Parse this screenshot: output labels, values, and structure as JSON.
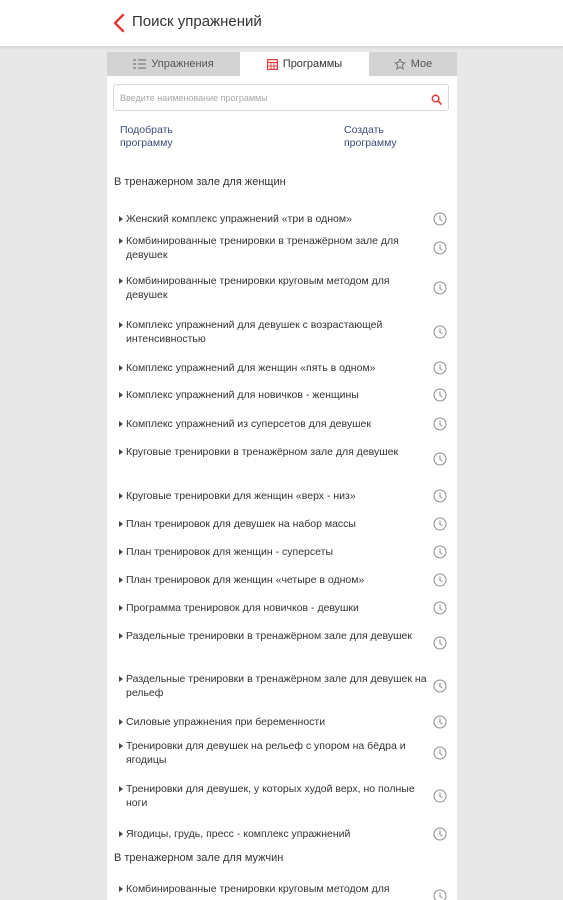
{
  "header": {
    "title": "Поиск упражнений"
  },
  "tabs": [
    {
      "label": "Упражнения",
      "icon": "list-icon"
    },
    {
      "label": "Программы",
      "icon": "calendar-icon"
    },
    {
      "label": "Мое",
      "icon": "star-icon"
    }
  ],
  "search": {
    "placeholder": "Введите наименование программы",
    "value": ""
  },
  "links": {
    "pick": "Подобрать программу",
    "create": "Создать программу"
  },
  "colors": {
    "accent": "#e53935",
    "link": "#3b4a7a"
  },
  "sections": [
    {
      "title": "В тренажерном зале для женщин",
      "items": [
        "Женский комплекс упражнений «три в одном»",
        "Комбинированные тренировки в тренажёрном зале для девушек",
        "Комбинированные тренировки круговым методом для девушек",
        "Комплекс упражнений для девушек с возрастающей интенсивностью",
        "Комплекс упражнений для женщин «пять в одном»",
        "Комплекс упражнений для новичков - женщины",
        "Комплекс упражнений из суперсетов для девушек",
        "Круговые тренировки в тренажёрном зале для девушек",
        "Круговые тренировки для женщин «верх - низ»",
        "План тренировок для девушек на набор массы",
        "План тренировок для женщин - суперсеты",
        "План тренировок для женщин «четыре в одном»",
        "Программа тренировок для новичков - девушки",
        "Раздельные тренировки в тренажёрном зале для девушек",
        "Раздельные тренировки в тренажёрном зале для девушек на рельеф",
        "Силовые упражнения при беременности",
        "Тренировки для девушек на рельеф с упором на бёдра и ягодицы",
        "Тренировки для девушек, у которых худой верх, но полные ноги",
        "Ягодицы, грудь, пресс - комплекс упражнений"
      ]
    },
    {
      "title": "В тренажерном зале для мужчин",
      "items": [
        "Комбинированные тренировки круговым методом для"
      ]
    }
  ]
}
